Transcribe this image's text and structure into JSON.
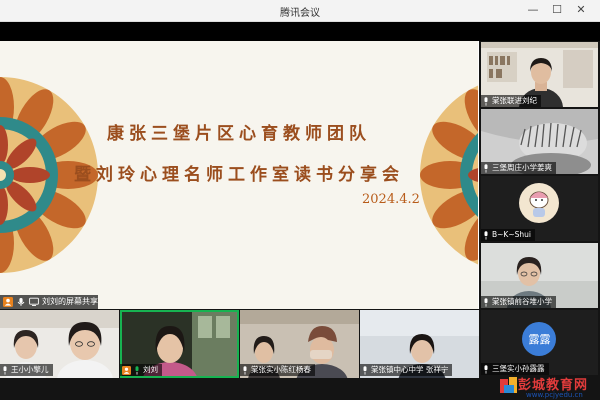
{
  "window": {
    "title": "腾讯会议",
    "minimize_symbol": "—",
    "maximize_symbol": "☐",
    "close_symbol": "✕"
  },
  "slide": {
    "line1": "康张三堡片区心育教师团队",
    "line2": "暨刘玲心理名师工作室读书分享会",
    "date": "2024.4.2"
  },
  "share_status": {
    "label": "刘刘的屏幕共享"
  },
  "side_participants": [
    {
      "name": "棠张联进刘纪"
    },
    {
      "name": "三堡周庄小学姜爽"
    },
    {
      "name": "B~K~Shui"
    },
    {
      "name": "棠张镇前谷堆小学"
    }
  ],
  "bottom_participants": [
    {
      "name": "王小小擎儿"
    },
    {
      "name": "刘刘"
    },
    {
      "name": "棠张实小陈红杨春"
    },
    {
      "name": "棠张镇中心中学 张祥宁"
    },
    {
      "name": "三堡实小孙露露",
      "avatar_text": "露露"
    }
  ],
  "watermark": {
    "text": "彭城教育网",
    "url": "www.pcjyedu.cn"
  },
  "colors": {
    "slide_text": "#9b4e1e",
    "date_text": "#b85c1a",
    "active_speaker": "#17b351",
    "avatar_bg": "#3b7dd8"
  }
}
